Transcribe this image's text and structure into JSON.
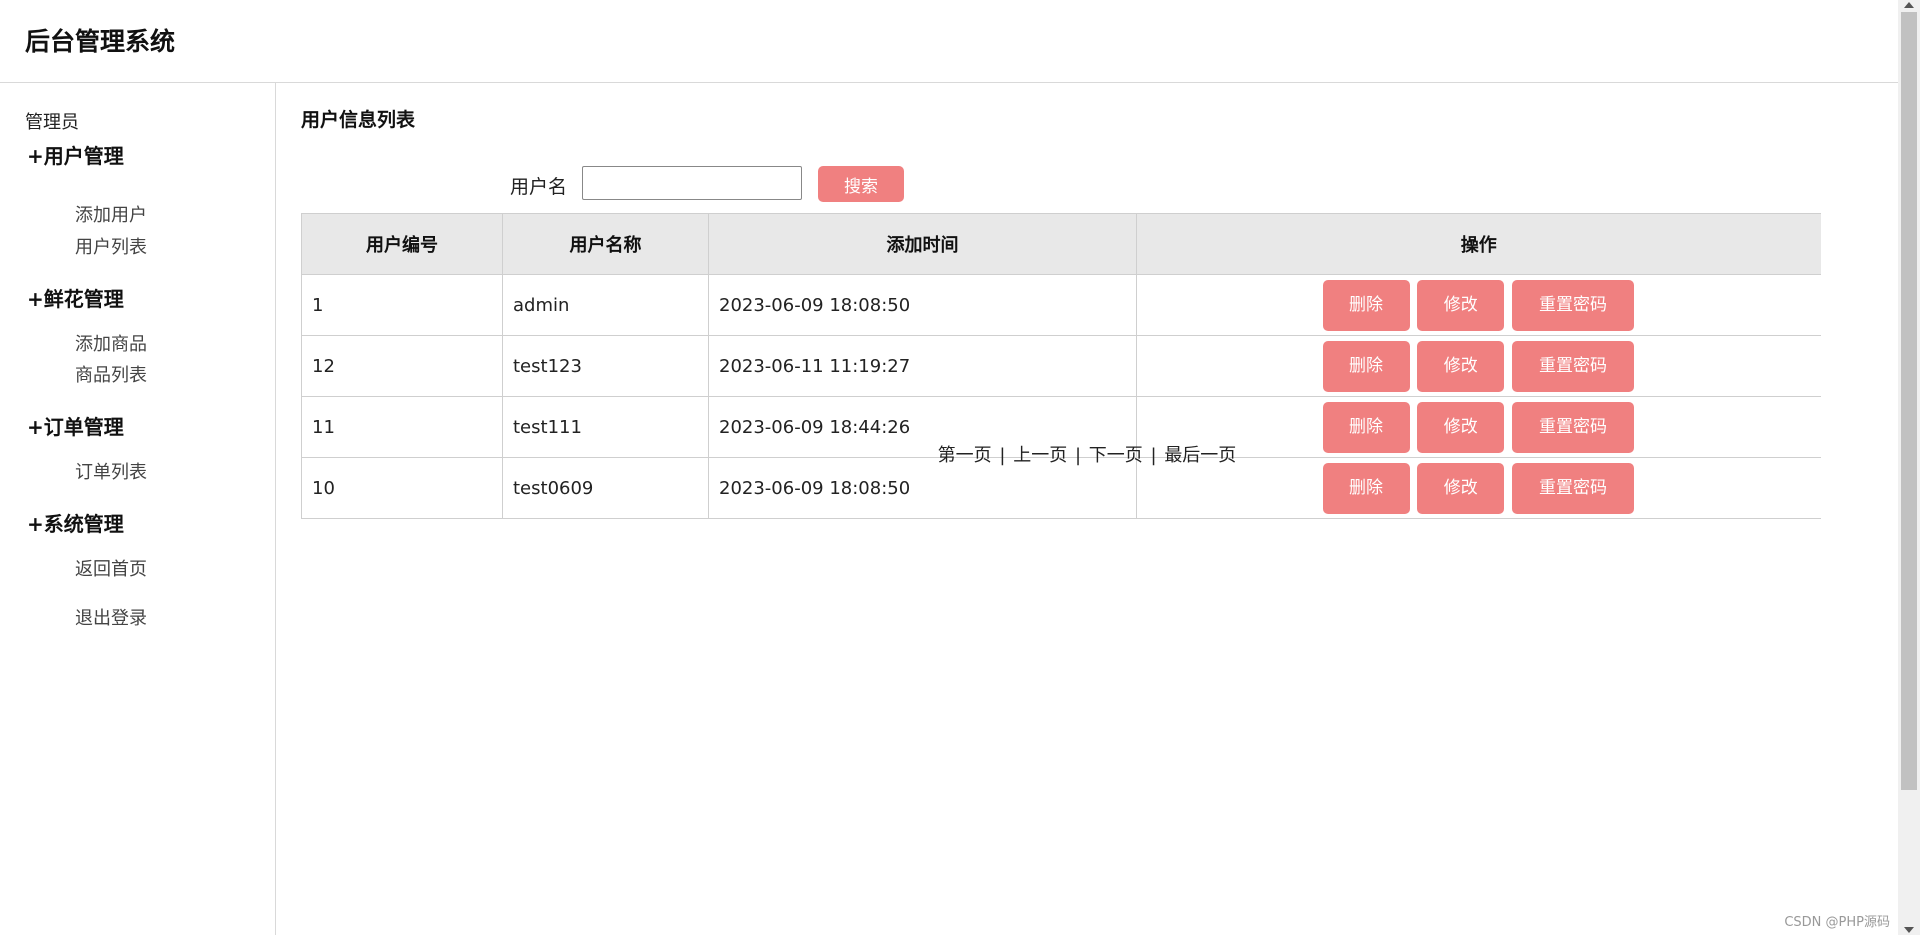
{
  "header": {
    "title": "后台管理系统"
  },
  "sidebar": {
    "role": "管理员",
    "groups": [
      {
        "title": "+用户管理",
        "items": [
          "添加用户",
          "用户列表"
        ]
      },
      {
        "title": "+鲜花管理",
        "items": [
          "添加商品",
          "商品列表"
        ]
      },
      {
        "title": "+订单管理",
        "items": [
          "订单列表"
        ]
      },
      {
        "title": "+系统管理",
        "items": [
          "返回首页",
          "退出登录"
        ]
      }
    ]
  },
  "main": {
    "title": "用户信息列表",
    "search": {
      "label": "用户名",
      "value": "",
      "placeholder": "",
      "button": "搜索"
    },
    "table": {
      "columns": [
        "用户编号",
        "用户名称",
        "添加时间",
        "操作"
      ],
      "rows": [
        {
          "id": "1",
          "name": "admin",
          "time": "2023-06-09 18:08:50"
        },
        {
          "id": "12",
          "name": "test123",
          "time": "2023-06-11 11:19:27"
        },
        {
          "id": "11",
          "name": "test111",
          "time": "2023-06-09 18:44:26"
        },
        {
          "id": "10",
          "name": "test0609",
          "time": "2023-06-09 18:08:50"
        }
      ],
      "actions": {
        "delete": "删除",
        "edit": "修改",
        "reset": "重置密码"
      }
    },
    "pager": {
      "first": "第一页",
      "prev": "上一页",
      "next": "下一页",
      "last": "最后一页",
      "separator": "|"
    }
  },
  "watermark": "CSDN @PHP源码",
  "colors": {
    "button_bg": "#f08080",
    "header_row_bg": "#e8e8e8",
    "border": "#cfcfcf"
  }
}
